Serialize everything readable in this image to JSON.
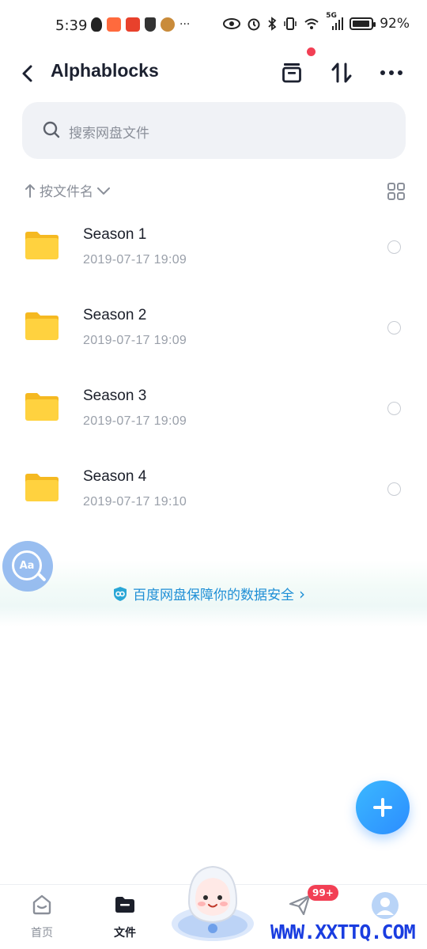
{
  "status_bar": {
    "time": "5:39",
    "battery_pct": "92%",
    "network_label": "5G",
    "more_dots": "···"
  },
  "header": {
    "title": "Alphablocks"
  },
  "search": {
    "placeholder": "搜索网盘文件"
  },
  "sort": {
    "label": "按文件名"
  },
  "files": [
    {
      "name": "Season 1",
      "date": "2019-07-17  19:09"
    },
    {
      "name": "Season 2",
      "date": "2019-07-17  19:09"
    },
    {
      "name": "Season 3",
      "date": "2019-07-17  19:09"
    },
    {
      "name": "Season 4",
      "date": "2019-07-17  19:10"
    }
  ],
  "floating_tool": {
    "label": "Aa"
  },
  "safety_banner": {
    "text": "百度网盘保障你的数据安全",
    "arrow": "›"
  },
  "bottom_nav": {
    "items": [
      {
        "label": "首页"
      },
      {
        "label": "文件"
      },
      {
        "label": ""
      },
      {
        "label": ""
      }
    ],
    "badge": "99+"
  },
  "watermark": "WWW.XXTTQ.COM",
  "colors": {
    "accent": "#2c8dff",
    "folder": "#ffd23f",
    "badge": "#f23f54",
    "link": "#1f8fd6"
  }
}
